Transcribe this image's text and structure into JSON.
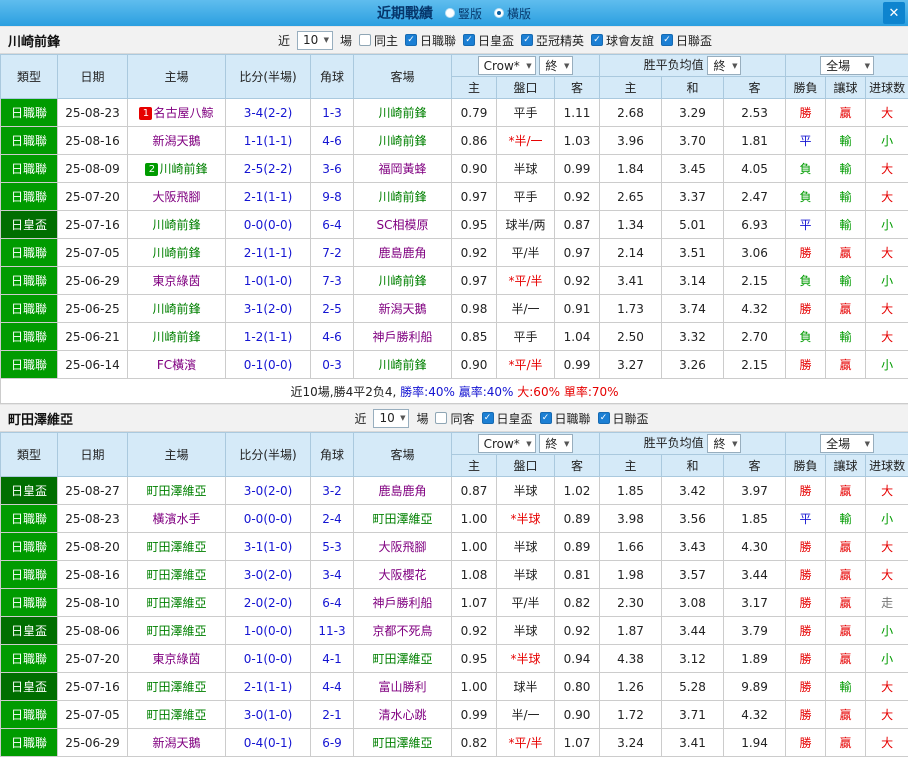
{
  "topbar": {
    "title": "近期戰績",
    "radio_options": [
      {
        "label": "豎版",
        "selected": false
      },
      {
        "label": "橫版",
        "selected": true
      }
    ],
    "close_label": "✕"
  },
  "table_header": {
    "type": "類型",
    "date": "日期",
    "home": "主場",
    "score": "比分(半場)",
    "corner": "角球",
    "away": "客場",
    "bookmaker_select": "Crow*",
    "final_select": "終",
    "home_odds": "主",
    "handicap": "盤口",
    "away_odds": "客",
    "avg_title": "胜平负均值",
    "avg_home": "主",
    "avg_draw": "和",
    "avg_away": "客",
    "fulltime_select": "全場",
    "result": "勝負",
    "handicap_result": "讓球",
    "goals": "进球数"
  },
  "colors": {
    "league_j": "#009b00",
    "league_cup": "#006e00",
    "win": "#e60000",
    "draw": "#1414d2",
    "lose": "#009b00",
    "focal_team": "#008000",
    "opponent_team": "#800080"
  },
  "sections": [
    {
      "team": "川崎前鋒",
      "filter": {
        "near": "近",
        "count": "10",
        "games": "場",
        "checkboxes": [
          {
            "label": "同主",
            "checked": false
          },
          {
            "label": "日職聯",
            "checked": true
          },
          {
            "label": "日皇盃",
            "checked": true
          },
          {
            "label": "亞冠精英",
            "checked": true
          },
          {
            "label": "球會友誼",
            "checked": true
          },
          {
            "label": "日聯盃",
            "checked": true
          }
        ]
      },
      "rows": [
        {
          "league": "日職聯",
          "league_color": "#009b00",
          "date": "25-08-23",
          "badge": {
            "text": "1",
            "color": "#e60000"
          },
          "home": "名古屋八鯨",
          "home_focal": false,
          "score": "3-4(2-2)",
          "corner": "1-3",
          "away": "川崎前鋒",
          "away_focal": true,
          "o1": "0.79",
          "hc": "平手",
          "hc_live": false,
          "o2": "1.11",
          "a1": "2.68",
          "a2": "3.29",
          "a3": "2.53",
          "res": "勝",
          "res_c": "r",
          "hr": "贏",
          "hr_c": "r",
          "gl": "大",
          "gl_c": "r"
        },
        {
          "league": "日職聯",
          "league_color": "#009b00",
          "date": "25-08-16",
          "home": "新潟天鵝",
          "home_focal": false,
          "score": "1-1(1-1)",
          "corner": "4-6",
          "away": "川崎前鋒",
          "away_focal": true,
          "o1": "0.86",
          "hc": "*半/一",
          "hc_live": true,
          "o2": "1.03",
          "a1": "3.96",
          "a2": "3.70",
          "a3": "1.81",
          "res": "平",
          "res_c": "b",
          "hr": "輸",
          "hr_c": "g",
          "gl": "小",
          "gl_c": "g"
        },
        {
          "league": "日職聯",
          "league_color": "#009b00",
          "date": "25-08-09",
          "badge": {
            "text": "2",
            "color": "#009b00"
          },
          "home": "川崎前鋒",
          "home_focal": true,
          "score": "2-5(2-2)",
          "corner": "3-6",
          "away": "福岡黃蜂",
          "away_focal": false,
          "o1": "0.90",
          "hc": "半球",
          "hc_live": false,
          "o2": "0.99",
          "a1": "1.84",
          "a2": "3.45",
          "a3": "4.05",
          "res": "負",
          "res_c": "g",
          "hr": "輸",
          "hr_c": "g",
          "gl": "大",
          "gl_c": "r"
        },
        {
          "league": "日職聯",
          "league_color": "#009b00",
          "date": "25-07-20",
          "home": "大阪飛腳",
          "home_focal": false,
          "score": "2-1(1-1)",
          "corner": "9-8",
          "away": "川崎前鋒",
          "away_focal": true,
          "o1": "0.97",
          "hc": "平手",
          "hc_live": false,
          "o2": "0.92",
          "a1": "2.65",
          "a2": "3.37",
          "a3": "2.47",
          "res": "負",
          "res_c": "g",
          "hr": "輸",
          "hr_c": "g",
          "gl": "大",
          "gl_c": "r"
        },
        {
          "league": "日皇盃",
          "league_color": "#006e00",
          "date": "25-07-16",
          "home": "川崎前鋒",
          "home_focal": true,
          "score": "0-0(0-0)",
          "corner": "6-4",
          "away": "SC相模原",
          "away_focal": false,
          "o1": "0.95",
          "hc": "球半/两",
          "hc_live": false,
          "o2": "0.87",
          "a1": "1.34",
          "a2": "5.01",
          "a3": "6.93",
          "res": "平",
          "res_c": "b",
          "hr": "輸",
          "hr_c": "g",
          "gl": "小",
          "gl_c": "g"
        },
        {
          "league": "日職聯",
          "league_color": "#009b00",
          "date": "25-07-05",
          "home": "川崎前鋒",
          "home_focal": true,
          "score": "2-1(1-1)",
          "corner": "7-2",
          "away": "鹿島鹿角",
          "away_focal": false,
          "o1": "0.92",
          "hc": "平/半",
          "hc_live": false,
          "o2": "0.97",
          "a1": "2.14",
          "a2": "3.51",
          "a3": "3.06",
          "res": "勝",
          "res_c": "r",
          "hr": "贏",
          "hr_c": "r",
          "gl": "大",
          "gl_c": "r"
        },
        {
          "league": "日職聯",
          "league_color": "#009b00",
          "date": "25-06-29",
          "home": "東京綠茵",
          "home_focal": false,
          "score": "1-0(1-0)",
          "corner": "7-3",
          "away": "川崎前鋒",
          "away_focal": true,
          "o1": "0.97",
          "hc": "*平/半",
          "hc_live": true,
          "o2": "0.92",
          "a1": "3.41",
          "a2": "3.14",
          "a3": "2.15",
          "res": "負",
          "res_c": "g",
          "hr": "輸",
          "hr_c": "g",
          "gl": "小",
          "gl_c": "g"
        },
        {
          "league": "日職聯",
          "league_color": "#009b00",
          "date": "25-06-25",
          "home": "川崎前鋒",
          "home_focal": true,
          "score": "3-1(2-0)",
          "corner": "2-5",
          "away": "新潟天鵝",
          "away_focal": false,
          "o1": "0.98",
          "hc": "半/一",
          "hc_live": false,
          "o2": "0.91",
          "a1": "1.73",
          "a2": "3.74",
          "a3": "4.32",
          "res": "勝",
          "res_c": "r",
          "hr": "贏",
          "hr_c": "r",
          "gl": "大",
          "gl_c": "r"
        },
        {
          "league": "日職聯",
          "league_color": "#009b00",
          "date": "25-06-21",
          "home": "川崎前鋒",
          "home_focal": true,
          "score": "1-2(1-1)",
          "corner": "4-6",
          "away": "神戶勝利船",
          "away_focal": false,
          "o1": "0.85",
          "hc": "平手",
          "hc_live": false,
          "o2": "1.04",
          "a1": "2.50",
          "a2": "3.32",
          "a3": "2.70",
          "res": "負",
          "res_c": "g",
          "hr": "輸",
          "hr_c": "g",
          "gl": "大",
          "gl_c": "r"
        },
        {
          "league": "日職聯",
          "league_color": "#009b00",
          "date": "25-06-14",
          "home": "FC橫濱",
          "home_focal": false,
          "score": "0-1(0-0)",
          "corner": "0-3",
          "away": "川崎前鋒",
          "away_focal": true,
          "o1": "0.90",
          "hc": "*平/半",
          "hc_live": true,
          "o2": "0.99",
          "a1": "3.27",
          "a2": "3.26",
          "a3": "2.15",
          "res": "勝",
          "res_c": "r",
          "hr": "贏",
          "hr_c": "r",
          "gl": "小",
          "gl_c": "g"
        }
      ],
      "summary": {
        "prefix": "近10場,勝4平2负4,",
        "stats": [
          {
            "text": "勝率:40%",
            "color": "blue"
          },
          {
            "text": "贏率:40%",
            "color": "blue"
          },
          {
            "text": "大:60%",
            "color": "red"
          },
          {
            "text": "單率:70%",
            "color": "red"
          }
        ]
      }
    },
    {
      "team": "町田澤維亞",
      "filter": {
        "near": "近",
        "count": "10",
        "games": "場",
        "checkboxes": [
          {
            "label": "同客",
            "checked": false
          },
          {
            "label": "日皇盃",
            "checked": true
          },
          {
            "label": "日職聯",
            "checked": true
          },
          {
            "label": "日聯盃",
            "checked": true
          }
        ]
      },
      "rows": [
        {
          "league": "日皇盃",
          "league_color": "#006e00",
          "date": "25-08-27",
          "home": "町田澤維亞",
          "home_focal": true,
          "score": "3-0(2-0)",
          "corner": "3-2",
          "away": "鹿島鹿角",
          "away_focal": false,
          "o1": "0.87",
          "hc": "半球",
          "hc_live": false,
          "o2": "1.02",
          "a1": "1.85",
          "a2": "3.42",
          "a3": "3.97",
          "res": "勝",
          "res_c": "r",
          "hr": "贏",
          "hr_c": "r",
          "gl": "大",
          "gl_c": "r"
        },
        {
          "league": "日職聯",
          "league_color": "#009b00",
          "date": "25-08-23",
          "home": "橫濱水手",
          "home_focal": false,
          "score": "0-0(0-0)",
          "corner": "2-4",
          "away": "町田澤維亞",
          "away_focal": true,
          "o1": "1.00",
          "hc": "*半球",
          "hc_live": true,
          "o2": "0.89",
          "a1": "3.98",
          "a2": "3.56",
          "a3": "1.85",
          "res": "平",
          "res_c": "b",
          "hr": "輸",
          "hr_c": "g",
          "gl": "小",
          "gl_c": "g"
        },
        {
          "league": "日職聯",
          "league_color": "#009b00",
          "date": "25-08-20",
          "home": "町田澤維亞",
          "home_focal": true,
          "score": "3-1(1-0)",
          "corner": "5-3",
          "away": "大阪飛腳",
          "away_focal": false,
          "o1": "1.00",
          "hc": "半球",
          "hc_live": false,
          "o2": "0.89",
          "a1": "1.66",
          "a2": "3.43",
          "a3": "4.30",
          "res": "勝",
          "res_c": "r",
          "hr": "贏",
          "hr_c": "r",
          "gl": "大",
          "gl_c": "r"
        },
        {
          "league": "日職聯",
          "league_color": "#009b00",
          "date": "25-08-16",
          "home": "町田澤維亞",
          "home_focal": true,
          "score": "3-0(2-0)",
          "corner": "3-4",
          "away": "大阪櫻花",
          "away_focal": false,
          "o1": "1.08",
          "hc": "半球",
          "hc_live": false,
          "o2": "0.81",
          "a1": "1.98",
          "a2": "3.57",
          "a3": "3.44",
          "res": "勝",
          "res_c": "r",
          "hr": "贏",
          "hr_c": "r",
          "gl": "大",
          "gl_c": "r"
        },
        {
          "league": "日職聯",
          "league_color": "#009b00",
          "date": "25-08-10",
          "home": "町田澤維亞",
          "home_focal": true,
          "score": "2-0(2-0)",
          "corner": "6-4",
          "away": "神戶勝利船",
          "away_focal": false,
          "o1": "1.07",
          "hc": "平/半",
          "hc_live": false,
          "o2": "0.82",
          "a1": "2.30",
          "a2": "3.08",
          "a3": "3.17",
          "res": "勝",
          "res_c": "r",
          "hr": "贏",
          "hr_c": "r",
          "gl": "走",
          "gl_c": "gy"
        },
        {
          "league": "日皇盃",
          "league_color": "#006e00",
          "date": "25-08-06",
          "home": "町田澤維亞",
          "home_focal": true,
          "score": "1-0(0-0)",
          "corner": "11-3",
          "away": "京都不死鳥",
          "away_focal": false,
          "o1": "0.92",
          "hc": "半球",
          "hc_live": false,
          "o2": "0.92",
          "a1": "1.87",
          "a2": "3.44",
          "a3": "3.79",
          "res": "勝",
          "res_c": "r",
          "hr": "贏",
          "hr_c": "r",
          "gl": "小",
          "gl_c": "g"
        },
        {
          "league": "日職聯",
          "league_color": "#009b00",
          "date": "25-07-20",
          "home": "東京綠茵",
          "home_focal": false,
          "score": "0-1(0-0)",
          "corner": "4-1",
          "away": "町田澤維亞",
          "away_focal": true,
          "o1": "0.95",
          "hc": "*半球",
          "hc_live": true,
          "o2": "0.94",
          "a1": "4.38",
          "a2": "3.12",
          "a3": "1.89",
          "res": "勝",
          "res_c": "r",
          "hr": "贏",
          "hr_c": "r",
          "gl": "小",
          "gl_c": "g"
        },
        {
          "league": "日皇盃",
          "league_color": "#006e00",
          "date": "25-07-16",
          "home": "町田澤維亞",
          "home_focal": true,
          "score": "2-1(1-1)",
          "corner": "4-4",
          "away": "富山勝利",
          "away_focal": false,
          "o1": "1.00",
          "hc": "球半",
          "hc_live": false,
          "o2": "0.80",
          "a1": "1.26",
          "a2": "5.28",
          "a3": "9.89",
          "res": "勝",
          "res_c": "r",
          "hr": "輸",
          "hr_c": "g",
          "gl": "大",
          "gl_c": "r"
        },
        {
          "league": "日職聯",
          "league_color": "#009b00",
          "date": "25-07-05",
          "home": "町田澤維亞",
          "home_focal": true,
          "score": "3-0(1-0)",
          "corner": "2-1",
          "away": "清水心跳",
          "away_focal": false,
          "o1": "0.99",
          "hc": "半/一",
          "hc_live": false,
          "o2": "0.90",
          "a1": "1.72",
          "a2": "3.71",
          "a3": "4.32",
          "res": "勝",
          "res_c": "r",
          "hr": "贏",
          "hr_c": "r",
          "gl": "大",
          "gl_c": "r"
        },
        {
          "league": "日職聯",
          "league_color": "#009b00",
          "date": "25-06-29",
          "home": "新潟天鵝",
          "home_focal": false,
          "score": "0-4(0-1)",
          "corner": "6-9",
          "away": "町田澤維亞",
          "away_focal": true,
          "o1": "0.82",
          "hc": "*平/半",
          "hc_live": true,
          "o2": "1.07",
          "a1": "3.24",
          "a2": "3.41",
          "a3": "1.94",
          "res": "勝",
          "res_c": "r",
          "hr": "贏",
          "hr_c": "r",
          "gl": "大",
          "gl_c": "r"
        }
      ],
      "summary": null
    }
  ]
}
